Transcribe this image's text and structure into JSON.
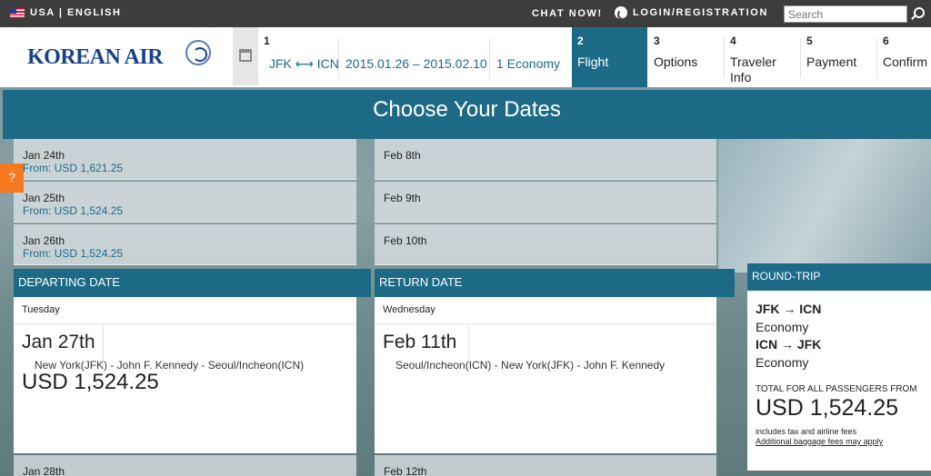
{
  "topbar": {
    "locale": "USA | ENGLISH",
    "chat": "CHAT NOW!",
    "login": "LOGIN/REGISTRATION",
    "search_placeholder": "Search"
  },
  "header": {
    "logo": "KOREAN AIR",
    "trip": {
      "step_num": "1",
      "route": "JFK ⟷ ICN",
      "dates": "2015.01.26 – 2015.02.10",
      "cabin": "1 Economy"
    },
    "steps": [
      {
        "num": "2",
        "label": "Flight"
      },
      {
        "num": "3",
        "label": "Options"
      },
      {
        "num": "4",
        "label": "Traveler Info"
      },
      {
        "num": "5",
        "label": "Payment"
      },
      {
        "num": "6",
        "label": "Confirm"
      }
    ]
  },
  "title": "Choose Your Dates",
  "help": "?",
  "depart_dates": [
    {
      "date": "Jan 24th",
      "price": "From: USD 1,621.25"
    },
    {
      "date": "Jan 25th",
      "price": "From: USD 1,524.25"
    },
    {
      "date": "Jan 26th",
      "price": "From: USD 1,524.25"
    }
  ],
  "return_dates": [
    {
      "date": "Feb 8th"
    },
    {
      "date": "Feb 9th"
    },
    {
      "date": "Feb 10th"
    }
  ],
  "departing": {
    "heading": "DEPARTING DATE",
    "weekday": "Tuesday",
    "date": "Jan 27th",
    "route": "New York(JFK) - John F. Kennedy - Seoul/Incheon(ICN)",
    "price": "USD 1,524.25",
    "next": "Jan 28th"
  },
  "returning": {
    "heading": "RETURN DATE",
    "weekday": "Wednesday",
    "date": "Feb 11th",
    "route": "Seoul/Incheon(ICN) - New York(JFK) - John F. Kennedy",
    "next": "Feb 12th"
  },
  "roundtrip": {
    "heading": "ROUND-TRIP",
    "leg1": "JFK → ICN",
    "class1": "Economy",
    "leg2": "ICN → JFK",
    "class2": "Economy",
    "total_label": "TOTAL FOR ALL PASSENGERS FROM",
    "total": "USD 1,524.25",
    "note": "includes tax and airline fees",
    "baggage_link": "Additional baggage fees may apply"
  }
}
